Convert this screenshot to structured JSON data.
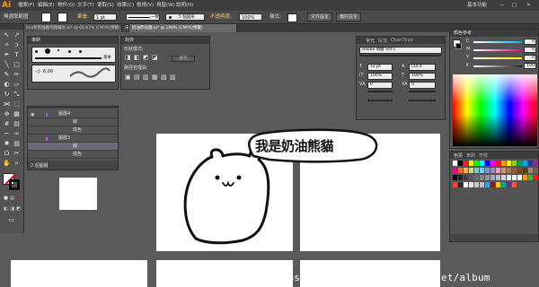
{
  "app": {
    "logo": "Ai"
  },
  "menubar": {
    "items": [
      "檔案(F)",
      "編輯(E)",
      "物件(O)",
      "文字(T)",
      "選取(S)",
      "效果(C)",
      "檢視(V)",
      "視窗(W)",
      "說明(H)"
    ],
    "workspace": "基本功能",
    "window_controls": [
      "—",
      "□",
      "✕"
    ]
  },
  "controlbar": {
    "selection_label": "無選取範圍",
    "stroke_label": "筆畫:",
    "stroke_value": "1 pt",
    "line_style": "一致",
    "brush_value": "5 點圓形",
    "opacity_label": "不透明度:",
    "opacity_value": "100%",
    "style_label": "樣式:",
    "doc_setup": "文件設定",
    "preferences": "偏好設定"
  },
  "tabs": [
    {
      "label": "line熊熊插圖完稿備份.ai* @ 66.67% (CMYK/預覽)"
    },
    {
      "label": "未命名-1* @ 66.67% (CMYK/預覽)"
    },
    {
      "label": "奶油熊貼圖.ai* @ 100% (CMYK/預覽)"
    }
  ],
  "brush_panel": {
    "title": "筆刷",
    "basic_label": "基本",
    "size_value": "6.00"
  },
  "layers_panel": {
    "rows": [
      {
        "name": "圖層4"
      },
      {
        "name": "線"
      },
      {
        "name": "底色"
      },
      {
        "name": "圖層3"
      },
      {
        "name": "線"
      },
      {
        "name": "底色"
      }
    ],
    "footer": "2 個圖層"
  },
  "align_panel": {
    "title": "對齊",
    "pathfinder_title": "路徑管理員",
    "shape_modes_label": "形狀模式:",
    "pathfinders_label": "路徑管理員:",
    "expand_label": "擴張"
  },
  "character_panel": {
    "tabs": [
      "字元",
      "段落",
      "OpenType"
    ],
    "font": "Adobe 明體 Std L",
    "size": "12 pt",
    "leading": "(14.4",
    "scale_v": "100%",
    "scale_h": "100%",
    "kerning": "0",
    "tracking": "0"
  },
  "color_panel": {
    "title": "顏色參考",
    "channels": [
      {
        "label": "C",
        "value": "0",
        "color": "#00aeef"
      },
      {
        "label": "M",
        "value": "0",
        "color": "#ec008c"
      },
      {
        "label": "Y",
        "value": "0",
        "color": "#fff200"
      },
      {
        "label": "K",
        "value": "100",
        "color": "#231f20"
      }
    ]
  },
  "swatches_panel": {
    "title": "色票",
    "tabs": [
      "色票",
      "筆刷",
      "符號"
    ]
  },
  "speech_bubble": {
    "text": "我是奶油熊貓"
  },
  "watermark": {
    "text": "https://miracle1235.pixnet.net/album"
  }
}
